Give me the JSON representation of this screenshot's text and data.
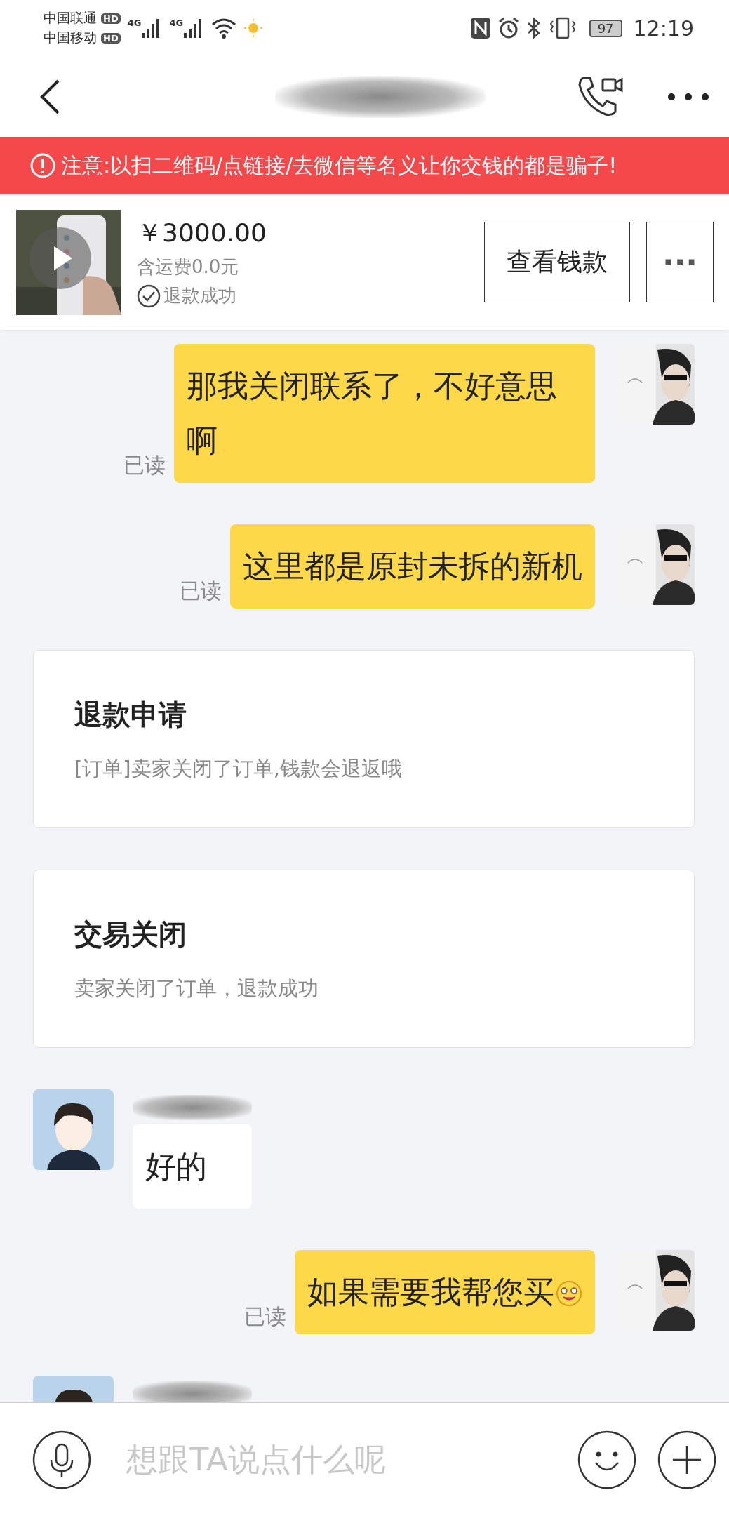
{
  "status_bar": {
    "carriers": [
      {
        "name": "中国联通",
        "badge": "HD"
      },
      {
        "name": "中国移动",
        "badge": "HD"
      }
    ],
    "network": [
      "4G",
      "4G"
    ],
    "battery": "97",
    "time": "12:19"
  },
  "warning_banner": {
    "text": "注意:以扫二维码/点链接/去微信等名义让你交钱的都是骗子!"
  },
  "product": {
    "price": "￥3000.00",
    "shipping": "含运费0.0元",
    "status": "退款成功",
    "view_button": "查看钱款",
    "more_button": "···"
  },
  "messages": [
    {
      "kind": "sent",
      "text": "那我关闭联系了，不好意思啊",
      "read_label": "已读"
    },
    {
      "kind": "sent",
      "text": "这里都是原封未拆的新机",
      "read_label": "已读"
    },
    {
      "kind": "card",
      "title": "退款申请",
      "text": "[订单]卖家关闭了订单,钱款会退返哦"
    },
    {
      "kind": "card",
      "title": "交易关闭",
      "text": "卖家关闭了订单，退款成功"
    },
    {
      "kind": "received",
      "text": "好的"
    },
    {
      "kind": "sent",
      "text": "如果需要我帮您买",
      "emoji": true,
      "read_label": "已读"
    },
    {
      "kind": "received"
    }
  ],
  "input_bar": {
    "placeholder": "想跟TA说点什么呢"
  }
}
